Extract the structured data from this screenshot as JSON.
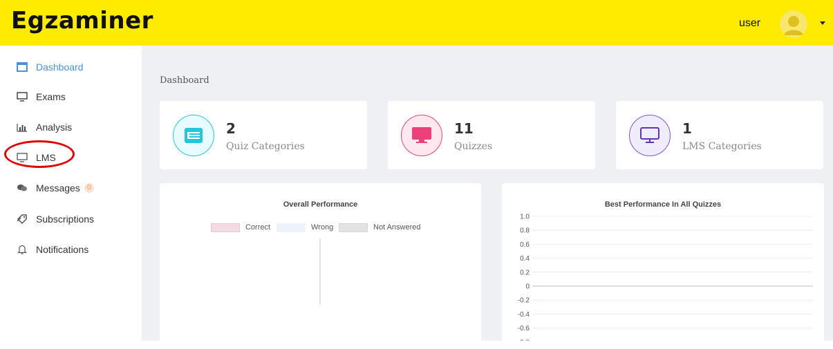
{
  "app": {
    "logo": "Egzaminer",
    "user_label": "user"
  },
  "sidebar": {
    "items": [
      {
        "label": "Dashboard",
        "icon": "dashboard-icon",
        "active": true
      },
      {
        "label": "Exams",
        "icon": "monitor-icon"
      },
      {
        "label": "Analysis",
        "icon": "bar-chart-icon"
      },
      {
        "label": "LMS",
        "icon": "monitor-icon"
      },
      {
        "label": "Messages",
        "icon": "chat-icon",
        "badge": "0"
      },
      {
        "label": "Subscriptions",
        "icon": "tag-icon"
      },
      {
        "label": "Notifications",
        "icon": "bell-icon"
      }
    ]
  },
  "breadcrumb": "Dashboard",
  "stats": [
    {
      "value": "2",
      "label": "Quiz Categories",
      "icon": "list-icon",
      "color": "#26c6da"
    },
    {
      "value": "11",
      "label": "Quizzes",
      "icon": "monitor-icon",
      "color": "#ec407a"
    },
    {
      "value": "1",
      "label": "LMS Categories",
      "icon": "monitor-icon",
      "color": "#7e57c2"
    }
  ],
  "charts": {
    "overall": {
      "title": "Overall Performance",
      "legend": [
        "Correct",
        "Wrong",
        "Not Answered"
      ]
    },
    "best": {
      "title": "Best Performance In All Quizzes"
    }
  },
  "chart_data": [
    {
      "type": "pie",
      "title": "Overall Performance",
      "categories": [
        "Correct",
        "Wrong",
        "Not Answered"
      ],
      "values": [],
      "legend": "top"
    },
    {
      "type": "line",
      "title": "Best Performance In All Quizzes",
      "y_ticks": [
        "1.0",
        "0.8",
        "0.6",
        "0.4",
        "0.2",
        "0",
        "-0.2",
        "-0.4",
        "-0.6",
        "-0.8"
      ],
      "ylim": [
        -0.8,
        1.0
      ],
      "series": [],
      "grid": true
    }
  ],
  "colors": {
    "header": "#ffeb00",
    "accent": "#4a90e2",
    "correct": "#f2dbe3",
    "wrong": "#eef3fb",
    "not_answered": "#e3e3e3"
  }
}
